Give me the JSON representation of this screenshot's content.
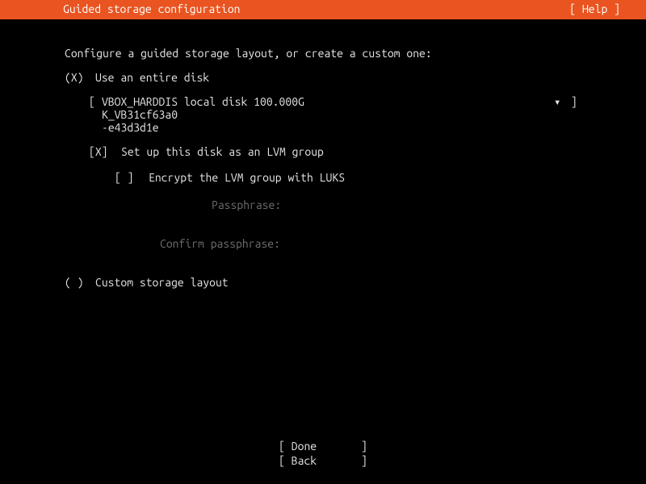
{
  "header": {
    "title": "Guided storage configuration",
    "help": "[ Help ]"
  },
  "intro": "Configure a guided storage layout, or create a custom one:",
  "option_entire_disk": {
    "radio": "(X)",
    "label": "Use an entire disk"
  },
  "disk_select": {
    "open": "[ ",
    "line1": "VBOX_HARDDIS local disk 100.000G",
    "line2": "K_VB31cf63a0",
    "line3": "-e43d3d1e",
    "arrow": "▾",
    "close": " ]"
  },
  "lvm": {
    "checkbox": "[X]",
    "label": "Set up this disk as an LVM group"
  },
  "luks": {
    "checkbox": "[ ]",
    "label": "Encrypt the LVM group with LUKS"
  },
  "passphrase": {
    "label": "Passphrase:"
  },
  "confirm": {
    "label": "Confirm passphrase:"
  },
  "option_custom": {
    "radio": "( )",
    "label": "Custom storage layout"
  },
  "buttons": {
    "done": "[ Done       ]",
    "back": "[ Back       ]"
  }
}
